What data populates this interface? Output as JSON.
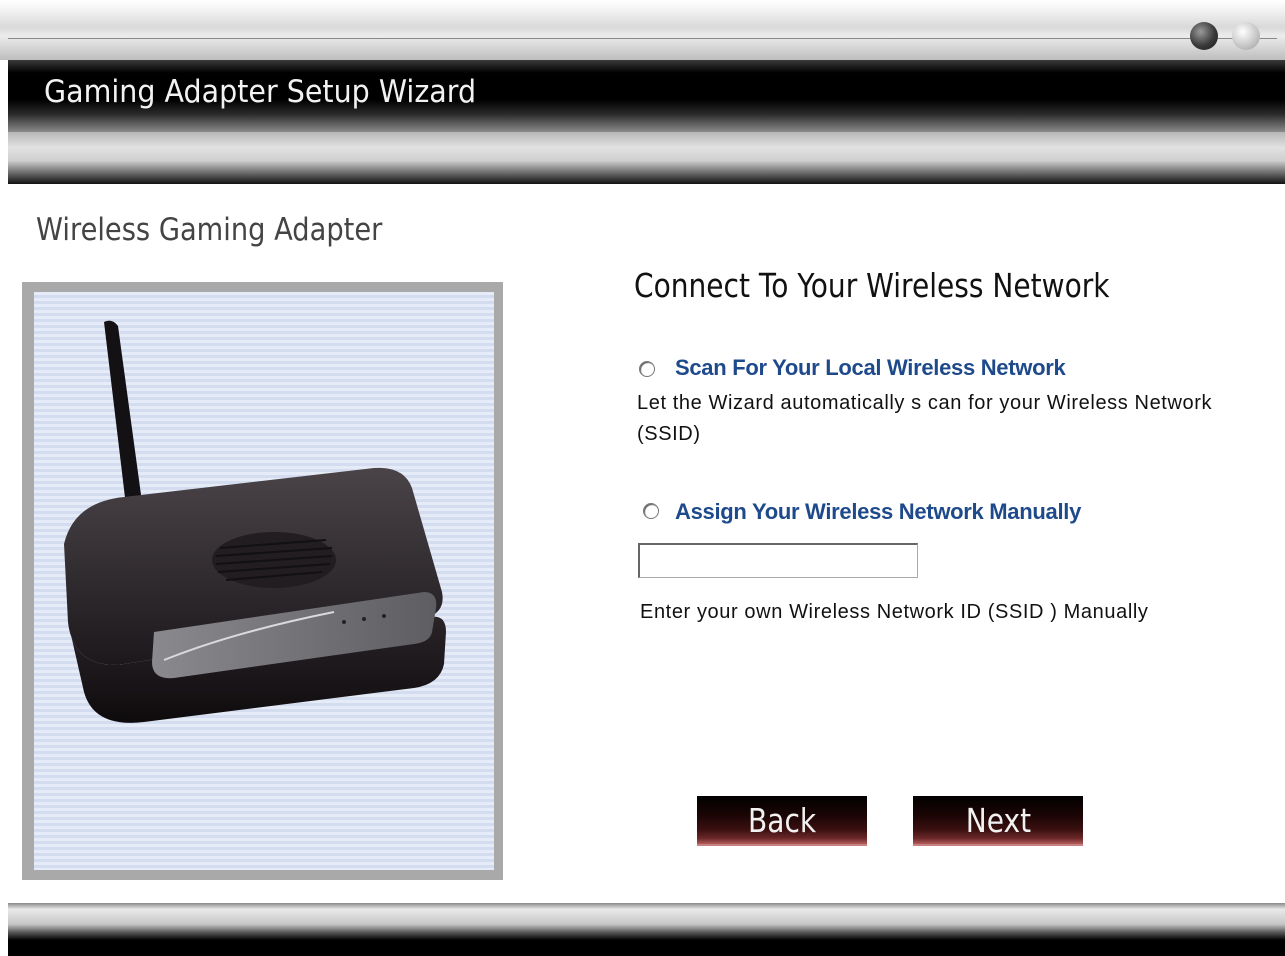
{
  "window": {
    "title": "Gaming Adapter Setup Wizard",
    "controls": [
      "minimize-icon",
      "close-icon"
    ]
  },
  "product": {
    "title": "Wireless Gaming Adapter",
    "image": "wireless-gaming-adapter-router-image"
  },
  "main": {
    "heading": "Connect To Your Wireless Network",
    "options": [
      {
        "label": "Scan For Your Local Wireless Network",
        "description": "Let the Wizard automatically s can for your Wireless Network (SSID)",
        "selected": false
      },
      {
        "label": "Assign Your Wireless Network Manually",
        "description": "Enter your own Wireless Network ID (SSID ) Manually",
        "selected": false
      }
    ],
    "ssid_input": {
      "value": "",
      "placeholder": ""
    }
  },
  "buttons": {
    "back": "Back",
    "next": "Next"
  },
  "colors": {
    "link_blue": "#1e4a8c",
    "button_dark_red": "#3a1010"
  }
}
